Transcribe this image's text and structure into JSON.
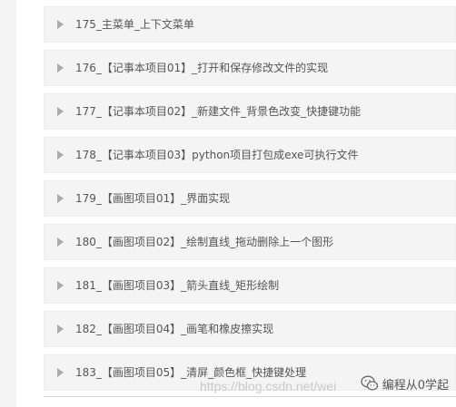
{
  "lessons": [
    {
      "label": "175_主菜单_上下文菜单"
    },
    {
      "label": "176_【记事本项目01】_打开和保存修改文件的实现"
    },
    {
      "label": "177_【记事本项目02】_新建文件_背景色改变_快捷键功能"
    },
    {
      "label": "178_【记事本项目03】python项目打包成exe可执行文件"
    },
    {
      "label": "179_【画图项目01】_界面实现"
    },
    {
      "label": "180_【画图项目02】_绘制直线_拖动删除上一个图形"
    },
    {
      "label": "181_【画图项目03】_箭头直线_矩形绘制"
    },
    {
      "label": "182_【画图项目04】_画笔和橡皮擦实现"
    },
    {
      "label": "183_【画图项目05】_清屏_颜色框_快捷键处理"
    }
  ],
  "watermark": {
    "url_text": "https://blog.csdn.net/wei",
    "account": "编程从0学起"
  },
  "icons": {
    "expand": "caret-right-icon",
    "wechat": "wechat-icon"
  }
}
